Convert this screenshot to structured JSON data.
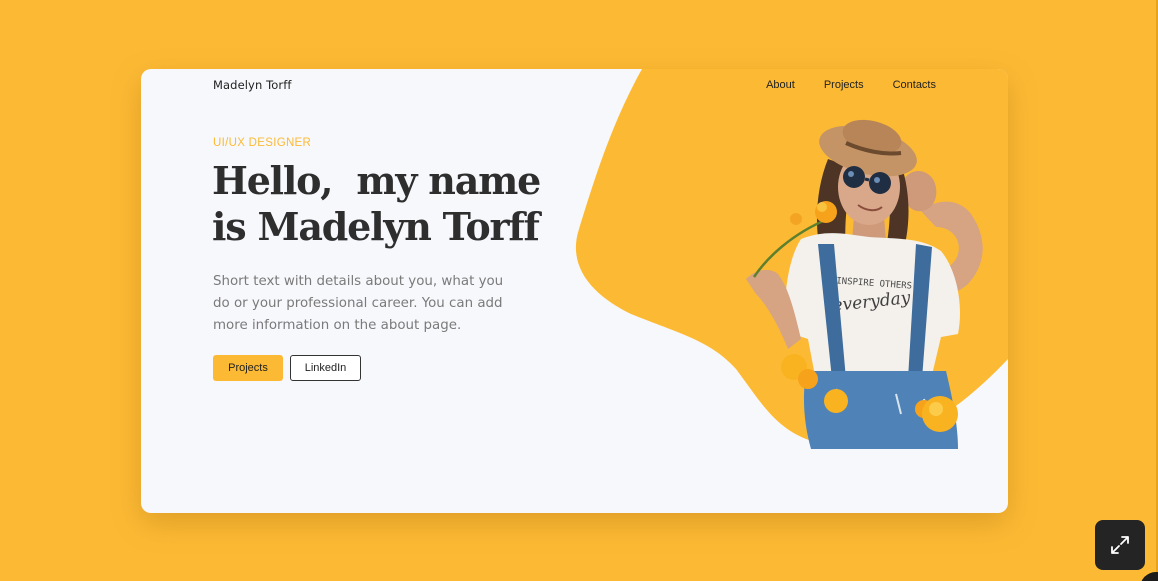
{
  "colors": {
    "accent": "#FCBA34",
    "card_background": "#F7F8FC",
    "heading": "#2E2E2E",
    "body_text": "#7A7A7A"
  },
  "header": {
    "brand": "Madelyn Torff",
    "nav": [
      {
        "label": "About"
      },
      {
        "label": "Projects"
      },
      {
        "label": "Contacts"
      }
    ]
  },
  "hero": {
    "eyebrow": "UI/UX DESIGNER",
    "headline_line1": "Hello,  my name",
    "headline_line2": "is Madelyn Torff",
    "intro_line1": "Short text with details about you, what you",
    "intro_line2": "do or your professional career. You can add",
    "intro_line3": "more information on the about page.",
    "buttons": {
      "primary": "Projects",
      "secondary": "LinkedIn"
    }
  },
  "portrait": {
    "shirt_text_top": "INSPIRE OTHERS",
    "shirt_text_script": "everyday"
  },
  "icons": {
    "expand": "expand-arrows-icon"
  }
}
